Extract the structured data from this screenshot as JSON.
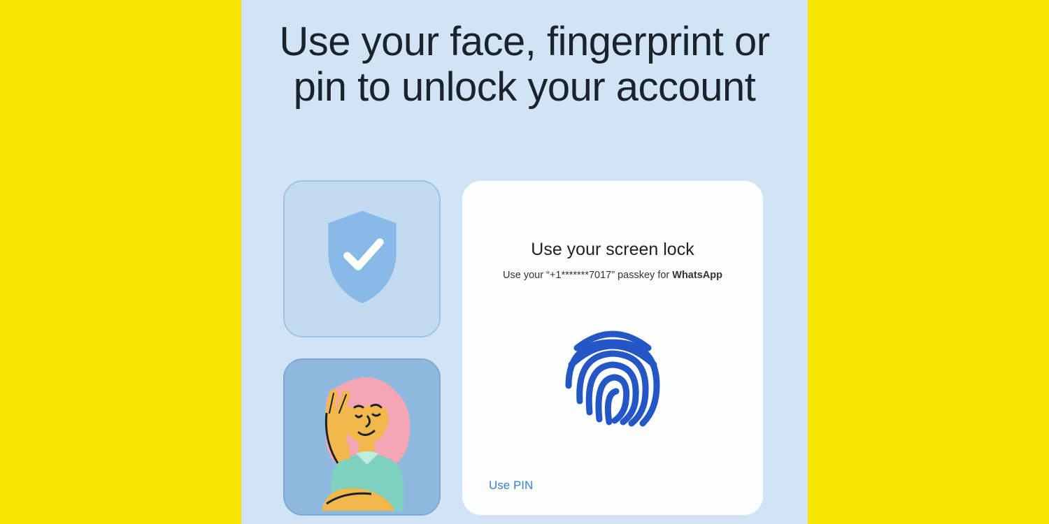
{
  "headline": "Use your face, fingerprint or pin to unlock your account",
  "lock_card": {
    "title": "Use your screen lock",
    "sub_prefix": "Use your “",
    "sub_passkey": "+1*******7017",
    "sub_mid": "” passkey for ",
    "sub_app": "WhatsApp",
    "use_pin_label": "Use PIN"
  },
  "colors": {
    "bg_outer": "#f7e600",
    "bg_inner": "#d0e4f5",
    "shield_fill": "#89b9e6",
    "shield_check": "#ffffff",
    "fingerprint": "#2457c5",
    "link": "#3a7fd5"
  },
  "icons": {
    "shield": "shield-check-icon",
    "fingerprint": "fingerprint-icon",
    "avatar": "person-peace-sign-illustration"
  }
}
